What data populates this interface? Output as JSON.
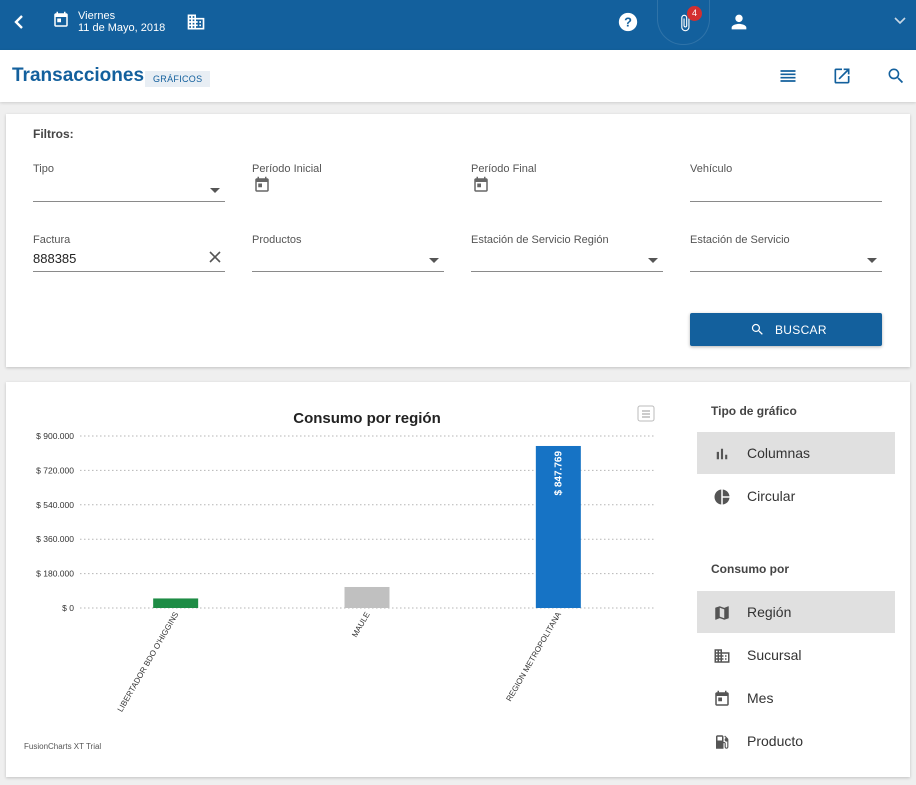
{
  "topbar": {
    "day": "Viernes",
    "date": "11 de Mayo, 2018",
    "badge": "4"
  },
  "header": {
    "title": "Transacciones",
    "chip": "GRÁFICOS"
  },
  "filters": {
    "title": "Filtros:",
    "tipo_label": "Tipo",
    "periodo_inicial_label": "Período Inicial",
    "periodo_final_label": "Período Final",
    "vehiculo_label": "Vehículo",
    "factura_label": "Factura",
    "factura_value": "888385",
    "productos_label": "Productos",
    "estacion_region_label": "Estación de Servicio Región",
    "estacion_label": "Estación de Servicio",
    "buscar_label": "BUSCAR"
  },
  "chart_data": {
    "type": "bar",
    "title": "Consumo por región",
    "categories": [
      "LIBERTADOR BDO O'HIGGINS",
      "MAULE",
      "REGION METROPOLITANA"
    ],
    "values": [
      50000,
      110000,
      847769
    ],
    "colors": [
      "#1e8c45",
      "#c0c0c0",
      "#1673c5"
    ],
    "yticks": [
      "$ 0",
      "$ 180.000",
      "$ 360.000",
      "$ 540.000",
      "$ 720.000",
      "$ 900.000"
    ],
    "ylim": [
      0,
      900000
    ],
    "data_labels": [
      "",
      "",
      "$ 847.769"
    ],
    "watermark": "FusionCharts XT Trial",
    "grid": true
  },
  "sidebar": {
    "tipo_header": "Tipo de gráfico",
    "tipo_options": [
      {
        "label": "Columnas",
        "icon": "bar-chart-icon",
        "selected": true
      },
      {
        "label": "Circular",
        "icon": "pie-chart-icon",
        "selected": false
      }
    ],
    "consumo_header": "Consumo por",
    "consumo_options": [
      {
        "label": "Región",
        "icon": "map-icon",
        "selected": true
      },
      {
        "label": "Sucursal",
        "icon": "building-icon",
        "selected": false
      },
      {
        "label": "Mes",
        "icon": "calendar-icon",
        "selected": false
      },
      {
        "label": "Producto",
        "icon": "gas-station-icon",
        "selected": false
      }
    ]
  }
}
